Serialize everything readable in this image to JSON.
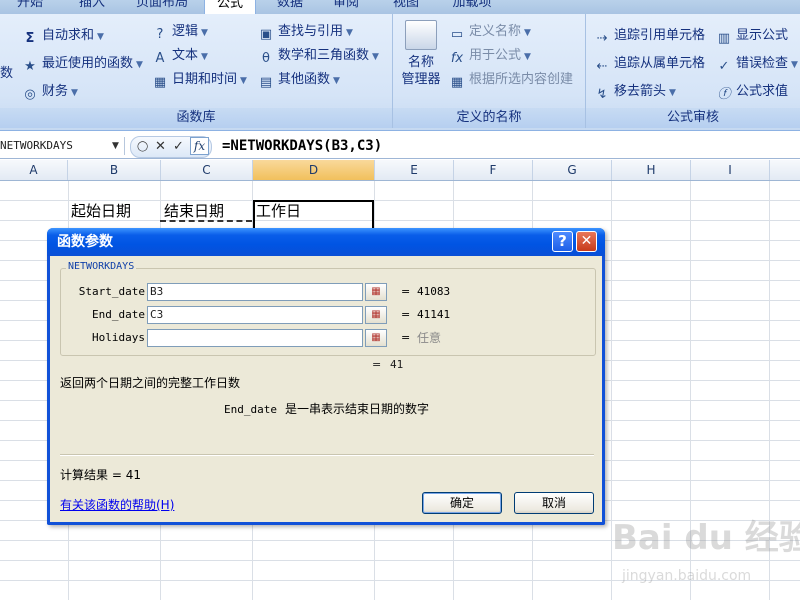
{
  "ribbon_tabs": [
    "开始",
    "插入",
    "页面布局",
    "公式",
    "数据",
    "审阅",
    "视图",
    "加载项"
  ],
  "active_tab": "公式",
  "groups": {
    "function_library": {
      "label": "函数库",
      "items": [
        "自动求和",
        "最近使用的函数",
        "财务",
        "逻辑",
        "文本",
        "日期和时间",
        "查找与引用",
        "数学和三角函数",
        "其他函数"
      ],
      "partial_left": "数"
    },
    "defined_names": {
      "label": "定义的名称",
      "name_manager": "名称\n管理器",
      "items": [
        "定义名称",
        "用于公式",
        "根据所选内容创建"
      ]
    },
    "formula_auditing": {
      "label": "公式审核",
      "items": [
        "追踪引用单元格",
        "追踪从属单元格",
        "移去箭头",
        "显示公式",
        "错误检查",
        "公式求值"
      ]
    }
  },
  "formula_bar": {
    "name_box": "NETWORKDAYS",
    "formula": "=NETWORKDAYS(B3,C3)"
  },
  "columns": [
    "A",
    "B",
    "C",
    "D",
    "E",
    "F",
    "G",
    "H",
    "I"
  ],
  "selected_column": "D",
  "cells": {
    "B2": "起始日期",
    "C2": "结束日期",
    "D2": "工作日"
  },
  "dialog": {
    "title": "函数参数",
    "function_name": "NETWORKDAYS",
    "args": [
      {
        "label": "Start_date",
        "value": "B3",
        "result": "41083"
      },
      {
        "label": "End_date",
        "value": "C3",
        "result": "41141"
      },
      {
        "label": "Holidays",
        "value": "",
        "result": "任意"
      }
    ],
    "formula_result": "41",
    "description": "返回两个日期之间的完整工作日数",
    "arg_help_name": "End_date",
    "arg_help_text": "是一串表示结束日期的数字",
    "calc_result_label": "计算结果 =",
    "calc_result_value": "41",
    "help_link": "有关该函数的帮助(H)",
    "ok": "确定",
    "cancel": "取消"
  },
  "watermark": {
    "logo": "Bai du 经验",
    "url": "jingyan.baidu.com"
  }
}
